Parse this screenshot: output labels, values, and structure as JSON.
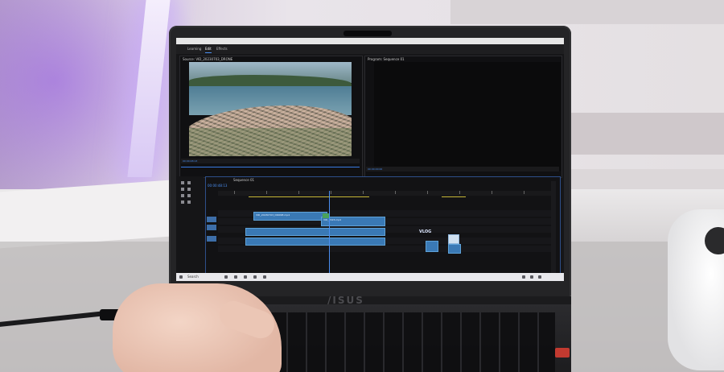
{
  "laptop": {
    "brand_logo": "/ISUS"
  },
  "app": {
    "workspaces": [
      {
        "label": "Learning"
      },
      {
        "label": "Edit"
      },
      {
        "label": "Effects"
      }
    ],
    "source_panel": {
      "title": "Source: VID_20230703_DRONE"
    },
    "program_panel": {
      "title": "Program: Sequence 01"
    },
    "source_timecode": "00:00:48:13",
    "program_timecode": "00:00:00:00",
    "timeline": {
      "sequence_tab": "Sequence 01",
      "current_time": "00:00:48:13",
      "clips": [
        {
          "label": "VID_20230703_DRONE.mp4"
        },
        {
          "label": "VID_2023.mp4"
        }
      ],
      "title_overlay": "VLOG"
    },
    "taskbar": {
      "search_placeholder": "Search"
    }
  }
}
